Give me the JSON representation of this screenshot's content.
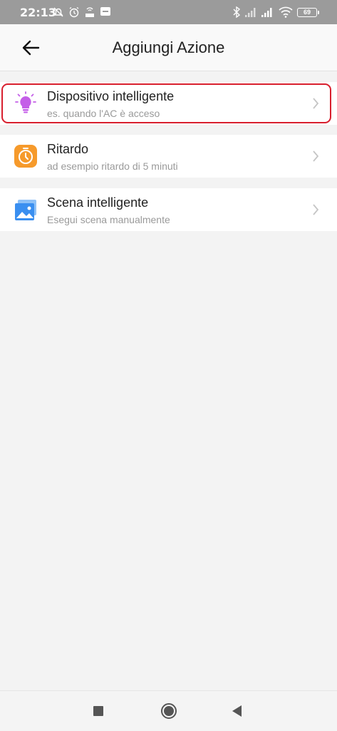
{
  "status_bar": {
    "time": "22:13",
    "battery": "69",
    "icons": [
      "mute-icon",
      "alarm-icon",
      "nfc-icon",
      "notification-icon",
      "bluetooth-icon",
      "signal-icon",
      "signal-icon",
      "wifi-icon",
      "battery-icon"
    ]
  },
  "header": {
    "title": "Aggiungi Azione",
    "back_icon": "arrow-left-icon"
  },
  "actions": [
    {
      "title": "Dispositivo intelligente",
      "subtitle": "es. quando l'AC è acceso",
      "icon": "lightbulb-icon",
      "highlighted": true
    },
    {
      "title": "Ritardo",
      "subtitle": "ad esempio ritardo di 5 minuti",
      "icon": "timer-icon",
      "highlighted": false
    },
    {
      "title": "Scena intelligente",
      "subtitle": "Esegui scena manualmente",
      "icon": "scene-icon",
      "highlighted": false
    }
  ],
  "colors": {
    "highlight": "#d81f2e",
    "lightbulb": "#c45ee8",
    "timer": "#f69a2b",
    "scene": "#3a8ff0"
  },
  "nav": {
    "icons": [
      "recents-icon",
      "home-icon",
      "back-icon"
    ]
  }
}
